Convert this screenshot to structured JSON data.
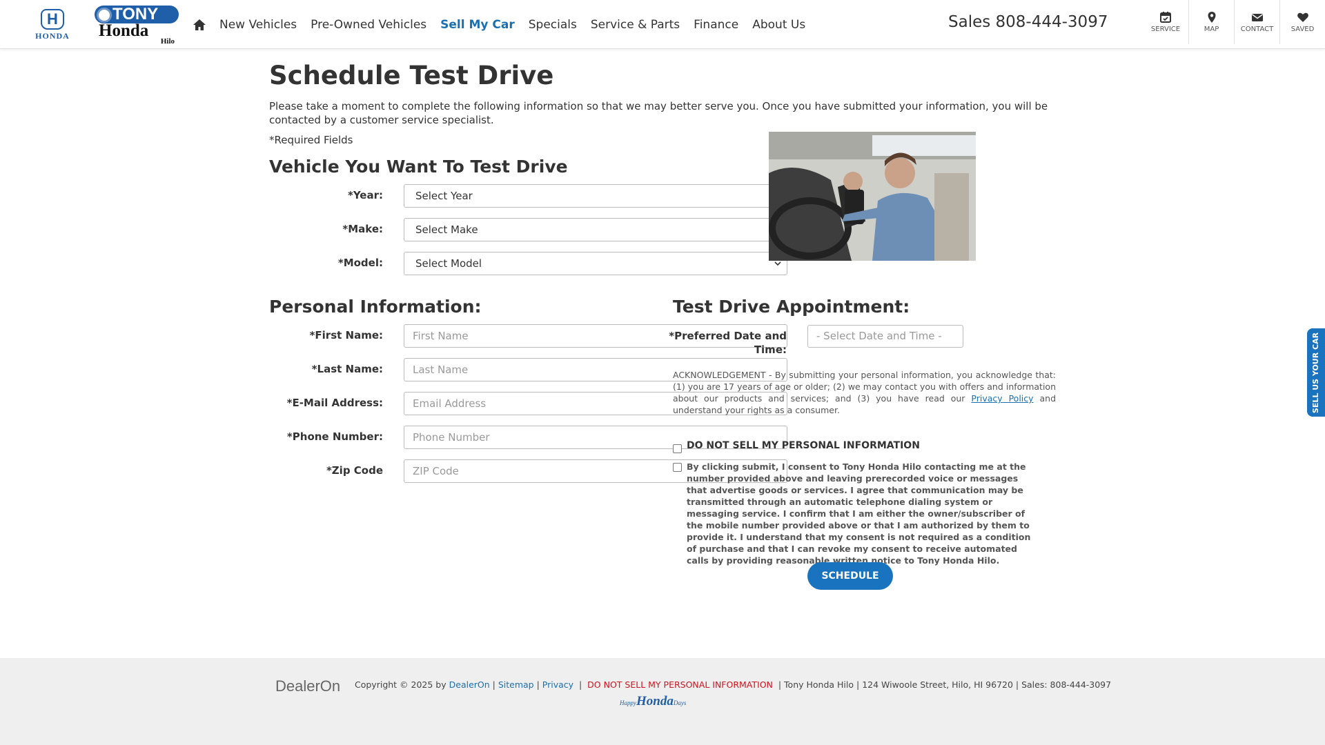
{
  "header": {
    "honda_logo_text": "HONDA",
    "dealer_logo": {
      "top": "TONY",
      "middle": "Honda",
      "bottom": "Hilo"
    },
    "nav": [
      "New Vehicles",
      "Pre-Owned Vehicles",
      "Sell My Car",
      "Specials",
      "Service & Parts",
      "Finance",
      "About Us"
    ],
    "active_nav": "Sell My Car",
    "sales_phone": "Sales 808-444-3097",
    "tools": [
      {
        "label": "SERVICE",
        "icon": "calendar-icon"
      },
      {
        "label": "MAP",
        "icon": "map-pin-icon"
      },
      {
        "label": "CONTACT",
        "icon": "envelope-icon"
      },
      {
        "label": "SAVED",
        "icon": "heart-icon"
      }
    ]
  },
  "page": {
    "title": "Schedule Test Drive",
    "intro": "Please take a moment to complete the following information so that we may better serve you. Once you have submitted your information, you will be contacted by a customer service specialist.",
    "required_note": "*Required Fields"
  },
  "vehicle": {
    "heading": "Vehicle You Want To Test Drive",
    "year_label": "*Year:",
    "year_value": "Select Year",
    "make_label": "*Make:",
    "make_value": "Select Make",
    "model_label": "*Model:",
    "model_value": "Select Model"
  },
  "personal": {
    "heading": "Personal Information:",
    "first_label": "*First Name:",
    "first_placeholder": "First Name",
    "last_label": "*Last Name:",
    "last_placeholder": "Last Name",
    "email_label": "*E-Mail Address:",
    "email_placeholder": "Email Address",
    "phone_label": "*Phone Number:",
    "phone_placeholder": "Phone Number",
    "zip_label": "*Zip Code",
    "zip_placeholder": "ZIP Code"
  },
  "appointment": {
    "heading": "Test Drive Appointment:",
    "date_label_1": "*Preferred Date and",
    "date_label_2": "Time:",
    "date_placeholder": "- Select Date and Time -",
    "ack_before": "ACKNOWLEDGEMENT - By submitting your personal information, you acknowledge that: (1) you are 17 years of age or older; (2) we may contact you with offers and information about our products and services; and (3) you have read our ",
    "ack_link": "Privacy Policy",
    "ack_after": " and understand your rights as a consumer.",
    "do_not_sell": "DO NOT SELL MY PERSONAL INFORMATION",
    "consent": "By clicking submit, I consent to Tony Honda Hilo contacting me at the number provided above and leaving prerecorded voice or messages that advertise goods or services. I agree that communication may be transmitted through an automatic telephone dialing system or messaging service. I confirm that I am either the owner/subscriber of the mobile number provided above or that I am authorized by them to provide it. I understand that my consent is not required as a condition of purchase and that I can revoke my consent to receive automated calls by providing reasonable written notice to Tony Honda Hilo.",
    "submit": "SCHEDULE"
  },
  "side_tab": "SELL US YOUR CAR",
  "footer": {
    "brand": "DealerOn",
    "copyright": "Copyright © 2025 by ",
    "dealeron_link": "DealerOn",
    "sitemap": "Sitemap",
    "privacy": "Privacy",
    "do_not_sell": "DO NOT SELL MY PERSONAL INFORMATION",
    "address": "Tony Honda Hilo | 124 Wiwoole Street, Hilo, HI 96720 | Sales: 808-444-3097",
    "happy_pre": "Happy",
    "happy_main": "Honda",
    "happy_post": "Days"
  },
  "colors": {
    "accent": "#1a73bf",
    "link": "#1a6fb3",
    "honda_blue": "#1f5ea8",
    "alert_red": "#d0121b"
  }
}
